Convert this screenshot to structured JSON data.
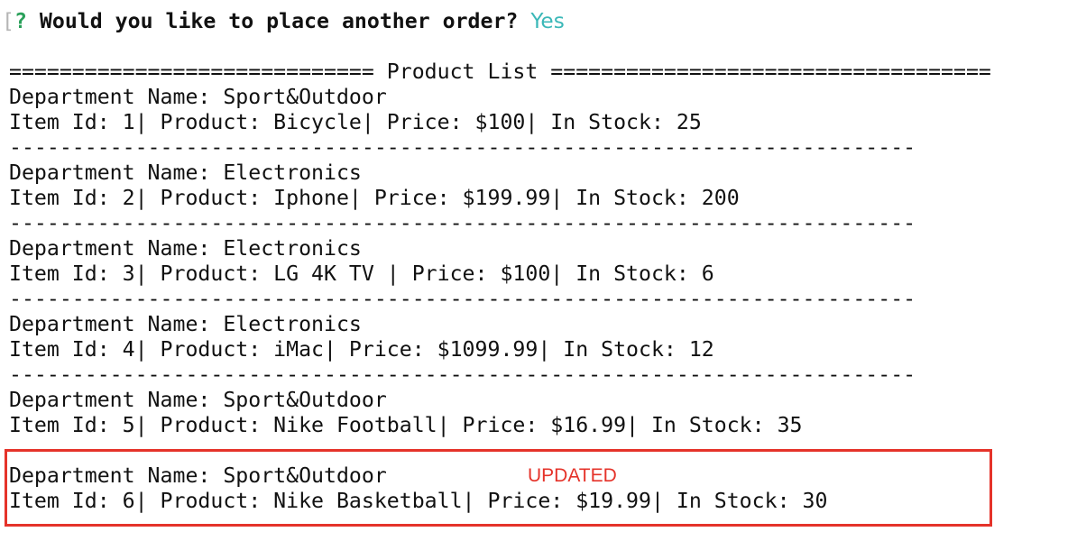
{
  "prompt": {
    "bracket": "[",
    "qmark": "?",
    "question": " Would you like to place another order? ",
    "answer": "Yes"
  },
  "header": {
    "line": "============================= Product List ==================================="
  },
  "separator": "------------------------------------------------------------------------",
  "products": [
    {
      "department": "Department Name: Sport&Outdoor",
      "item": "Item Id: 1| Product: Bicycle| Price: $100| In Stock: 25"
    },
    {
      "department": "Department Name: Electronics",
      "item": "Item Id: 2| Product: Iphone| Price: $199.99| In Stock: 200"
    },
    {
      "department": "Department Name: Electronics",
      "item": "Item Id: 3| Product: LG 4K TV | Price: $100| In Stock: 6"
    },
    {
      "department": "Department Name: Electronics",
      "item": "Item Id: 4| Product: iMac| Price: $1099.99| In Stock: 12"
    },
    {
      "department": "Department Name: Sport&Outdoor",
      "item": "Item Id: 5| Product: Nike Football| Price: $16.99| In Stock: 35"
    },
    {
      "department": "Department Name: Sport&Outdoor",
      "item": "Item Id: 6| Product: Nike Basketball| Price: $19.99| In Stock: 30"
    }
  ],
  "annotation": {
    "label": "UPDATED",
    "color": "#e5332a"
  },
  "colors": {
    "prompt_qmark": "#2aa05a",
    "answer": "#3bb8b8",
    "text": "#111111",
    "background": "#ffffff"
  }
}
